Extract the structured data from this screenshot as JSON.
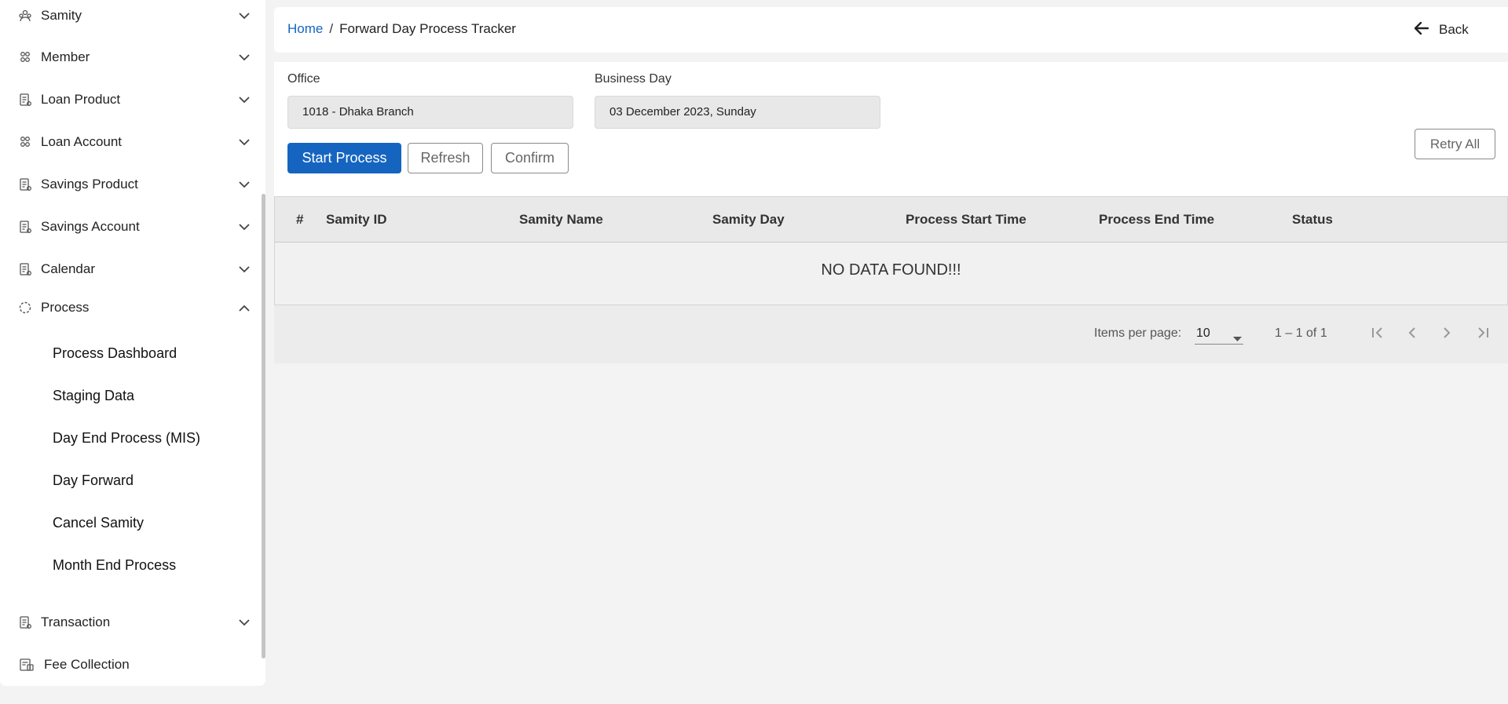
{
  "sidebar": {
    "items": [
      {
        "label": "Samity",
        "icon": "samity-icon",
        "chevron": "down"
      },
      {
        "label": "Member",
        "icon": "member-icon",
        "chevron": "down"
      },
      {
        "label": "Loan Product",
        "icon": "document-icon",
        "chevron": "down"
      },
      {
        "label": "Loan Account",
        "icon": "member-icon",
        "chevron": "down"
      },
      {
        "label": "Savings Product",
        "icon": "document-icon",
        "chevron": "down"
      },
      {
        "label": "Savings Account",
        "icon": "document-icon",
        "chevron": "down"
      },
      {
        "label": "Calendar",
        "icon": "document-icon",
        "chevron": "down"
      },
      {
        "label": "Process",
        "icon": "process-icon",
        "chevron": "up"
      },
      {
        "label": "Transaction",
        "icon": "document-icon",
        "chevron": "down"
      },
      {
        "label": "Fee Collection",
        "icon": "fee-collection-icon",
        "chevron": ""
      }
    ],
    "process_sub_items": [
      "Process Dashboard",
      "Staging Data",
      "Day End Process (MIS)",
      "Day Forward",
      "Cancel Samity",
      "Month End Process"
    ]
  },
  "header": {
    "breadcrumb_home": "Home",
    "breadcrumb_separator": "/",
    "breadcrumb_current": "Forward Day Process Tracker",
    "back_label": "Back"
  },
  "form": {
    "office_label": "Office",
    "office_value": "1018 - Dhaka Branch",
    "business_day_label": "Business Day",
    "business_day_value": "03 December 2023, Sunday"
  },
  "actions": {
    "start_process": "Start Process",
    "refresh": "Refresh",
    "confirm": "Confirm",
    "retry_all": "Retry All"
  },
  "table": {
    "columns": [
      "#",
      "Samity ID",
      "Samity Name",
      "Samity Day",
      "Process Start Time",
      "Process End Time",
      "Status"
    ],
    "empty_message": "NO DATA FOUND!!!"
  },
  "paginator": {
    "items_per_page_label": "Items per page:",
    "items_per_page_value": "10",
    "range_label": "1 – 1 of 1"
  },
  "colors": {
    "primary": "#1565c0",
    "link": "#1565c0",
    "page_background": "#f3f3f3"
  }
}
